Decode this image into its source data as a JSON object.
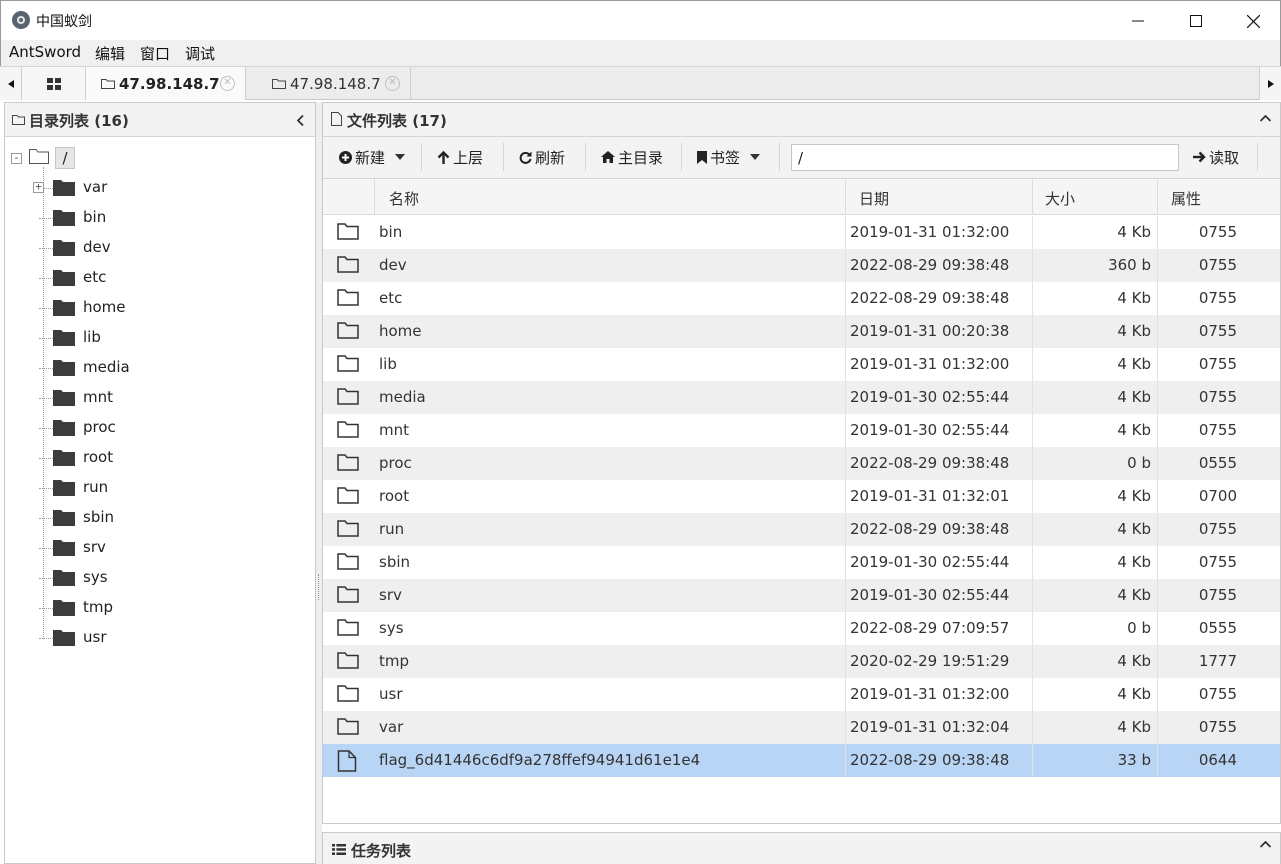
{
  "window": {
    "title": "中国蚁剑"
  },
  "menu": [
    "AntSword",
    "编辑",
    "窗口",
    "调试"
  ],
  "tabs": [
    {
      "label": "47.98.148.7",
      "active": true
    },
    {
      "label": "47.98.148.7",
      "active": false
    }
  ],
  "left_panel": {
    "title": "目录列表 (16)",
    "root": "/",
    "items": [
      "var",
      "bin",
      "dev",
      "etc",
      "home",
      "lib",
      "media",
      "mnt",
      "proc",
      "root",
      "run",
      "sbin",
      "srv",
      "sys",
      "tmp",
      "usr"
    ]
  },
  "right_panel": {
    "title": "文件列表 (17)",
    "toolbar": {
      "new": "新建",
      "up": "上层",
      "refresh": "刷新",
      "home": "主目录",
      "bookmark": "书签",
      "path_value": "/",
      "read": "读取"
    },
    "columns": [
      "名称",
      "日期",
      "大小",
      "属性"
    ],
    "rows": [
      {
        "type": "folder",
        "name": "bin",
        "date": "2019-01-31 01:32:00",
        "size": "4 Kb",
        "attr": "0755"
      },
      {
        "type": "folder",
        "name": "dev",
        "date": "2022-08-29 09:38:48",
        "size": "360 b",
        "attr": "0755"
      },
      {
        "type": "folder",
        "name": "etc",
        "date": "2022-08-29 09:38:48",
        "size": "4 Kb",
        "attr": "0755"
      },
      {
        "type": "folder",
        "name": "home",
        "date": "2019-01-31 00:20:38",
        "size": "4 Kb",
        "attr": "0755"
      },
      {
        "type": "folder",
        "name": "lib",
        "date": "2019-01-31 01:32:00",
        "size": "4 Kb",
        "attr": "0755"
      },
      {
        "type": "folder",
        "name": "media",
        "date": "2019-01-30 02:55:44",
        "size": "4 Kb",
        "attr": "0755"
      },
      {
        "type": "folder",
        "name": "mnt",
        "date": "2019-01-30 02:55:44",
        "size": "4 Kb",
        "attr": "0755"
      },
      {
        "type": "folder",
        "name": "proc",
        "date": "2022-08-29 09:38:48",
        "size": "0 b",
        "attr": "0555"
      },
      {
        "type": "folder",
        "name": "root",
        "date": "2019-01-31 01:32:01",
        "size": "4 Kb",
        "attr": "0700"
      },
      {
        "type": "folder",
        "name": "run",
        "date": "2022-08-29 09:38:48",
        "size": "4 Kb",
        "attr": "0755"
      },
      {
        "type": "folder",
        "name": "sbin",
        "date": "2019-01-30 02:55:44",
        "size": "4 Kb",
        "attr": "0755"
      },
      {
        "type": "folder",
        "name": "srv",
        "date": "2019-01-30 02:55:44",
        "size": "4 Kb",
        "attr": "0755"
      },
      {
        "type": "folder",
        "name": "sys",
        "date": "2022-08-29 07:09:57",
        "size": "0 b",
        "attr": "0555"
      },
      {
        "type": "folder",
        "name": "tmp",
        "date": "2020-02-29 19:51:29",
        "size": "4 Kb",
        "attr": "1777"
      },
      {
        "type": "folder",
        "name": "usr",
        "date": "2019-01-31 01:32:00",
        "size": "4 Kb",
        "attr": "0755"
      },
      {
        "type": "folder",
        "name": "var",
        "date": "2019-01-31 01:32:04",
        "size": "4 Kb",
        "attr": "0755"
      },
      {
        "type": "file",
        "name": "flag_6d41446c6df9a278ffef94941d61e1e4",
        "date": "2022-08-29 09:38:48",
        "size": "33 b",
        "attr": "0644",
        "selected": true
      }
    ]
  },
  "task_panel": {
    "title": "任务列表"
  },
  "colors": {
    "selected_row": "#b9d5f5",
    "alt_row": "#efefef",
    "panel_header": "#f3f3f3"
  }
}
